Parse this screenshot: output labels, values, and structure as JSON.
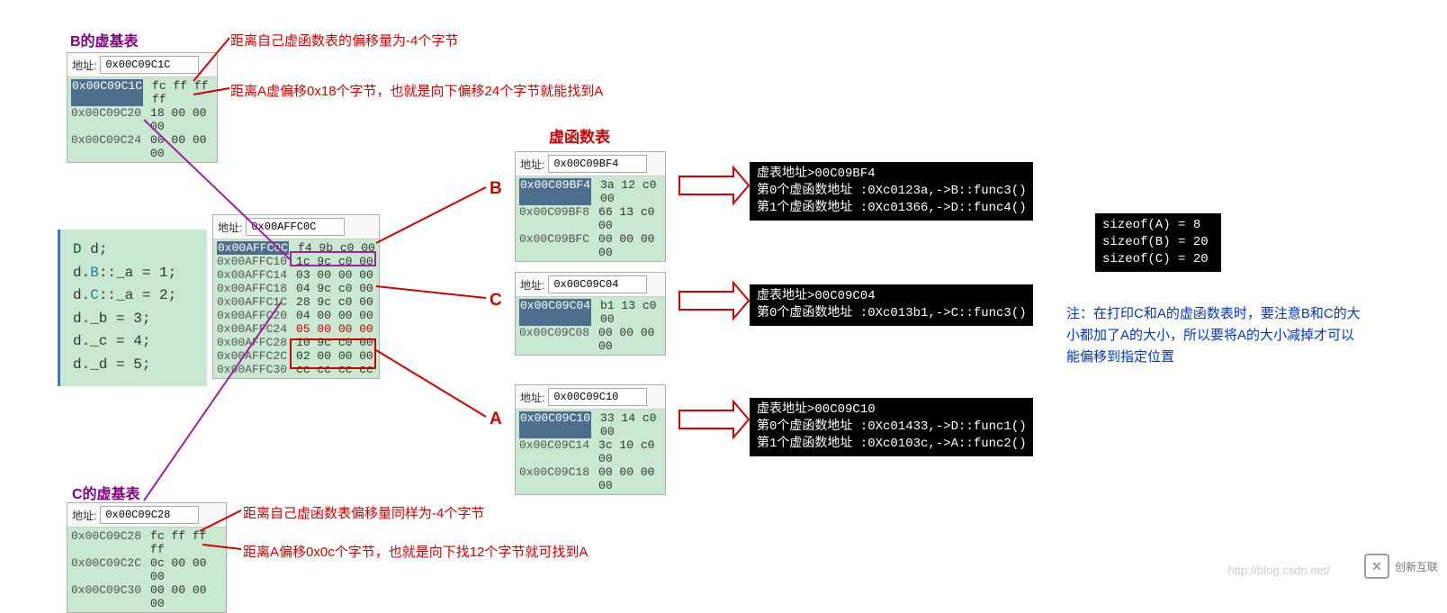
{
  "titles": {
    "b_vbtable": "B的虚基表",
    "c_vbtable": "C的虚基表",
    "vftable": "虚函数表"
  },
  "annotations": {
    "b_line1": "距离自己虚函数表的偏移量为-4个字节",
    "b_line2": "距离A虚偏移0x18个字节，也就是向下偏移24个字节就能找到A",
    "c_line1": "距离自己虚函数表偏移量同样为-4个字节",
    "c_line2": "距离A偏移0x0c个字节，也就是向下找12个字节就可找到A",
    "note_blue": "注：在打印C和A的虚函数表时，要注意B和C的大小都加了A的大小，所以要将A的大小减掉才可以能偏移到指定位置"
  },
  "letters": {
    "B": "B",
    "C": "C",
    "A": "A"
  },
  "mem_b": {
    "label": "地址:",
    "addr": "0x00C09C1C",
    "rows": [
      {
        "a": "0x00C09C1C",
        "b": "fc ff ff ff"
      },
      {
        "a": "0x00C09C20",
        "b": "18 00 00 00"
      },
      {
        "a": "0x00C09C24",
        "b": "00 00 00 00"
      }
    ]
  },
  "mem_c": {
    "label": "地址:",
    "addr": "0x00C09C28",
    "rows": [
      {
        "a": "0x00C09C28",
        "b": "fc ff ff ff"
      },
      {
        "a": "0x00C09C2C",
        "b": "0c 00 00 00"
      },
      {
        "a": "0x00C09C30",
        "b": "00 00 00 00"
      }
    ]
  },
  "mem_main": {
    "label": "地址:",
    "addr": "0x00AFFC0C",
    "rows": [
      {
        "a": "0x00AFFC0C",
        "b": "f4 9b c0 00"
      },
      {
        "a": "0x00AFFC10",
        "b": "1c 9c c0 00"
      },
      {
        "a": "0x00AFFC14",
        "b": "03 00 00 00"
      },
      {
        "a": "0x00AFFC18",
        "b": "04 9c c0 00"
      },
      {
        "a": "0x00AFFC1C",
        "b": "28 9c c0 00"
      },
      {
        "a": "0x00AFFC20",
        "b": "04 00 00 00"
      },
      {
        "a": "0x00AFFC24",
        "b": "05 00 00 00"
      },
      {
        "a": "0x00AFFC28",
        "b": "10 9c c0 00"
      },
      {
        "a": "0x00AFFC2C",
        "b": "02 00 00 00"
      },
      {
        "a": "0x00AFFC30",
        "b": "cc cc cc cc"
      }
    ]
  },
  "mem_vb": {
    "label": "地址:",
    "addr": "0x00C09BF4",
    "rows": [
      {
        "a": "0x00C09BF4",
        "b": "3a 12 c0 00"
      },
      {
        "a": "0x00C09BF8",
        "b": "66 13 c0 00"
      },
      {
        "a": "0x00C09BFC",
        "b": "00 00 00 00"
      }
    ]
  },
  "mem_vc": {
    "label": "地址:",
    "addr": "0x00C09C04",
    "rows": [
      {
        "a": "0x00C09C04",
        "b": "b1 13 c0 00"
      },
      {
        "a": "0x00C09C08",
        "b": "00 00 00 00"
      }
    ]
  },
  "mem_va": {
    "label": "地址:",
    "addr": "0x00C09C10",
    "rows": [
      {
        "a": "0x00C09C10",
        "b": "33 14 c0 00"
      },
      {
        "a": "0x00C09C14",
        "b": "3c 10 c0 00"
      },
      {
        "a": "0x00C09C18",
        "b": "00 00 00 00"
      }
    ]
  },
  "code": {
    "l1a": "D",
    "l1b": " d;",
    "l2a": "d.",
    "l2b": "B",
    "l2c": "::_a = 1;",
    "l3a": "d.",
    "l3b": "C",
    "l3c": "::_a = 2;",
    "l4": "d._b = 3;",
    "l5": "d._c = 4;",
    "l6": "d._d = 5;"
  },
  "term_b": "虚表地址>00C09BF4\n第0个虚函数地址 :0Xc0123a,->B::func3()\n第1个虚函数地址 :0Xc01366,->D::func4()",
  "term_c": "虚表地址>00C09C04\n第0个虚函数地址 :0Xc013b1,->C::func3()",
  "term_a": "虚表地址>00C09C10\n第0个虚函数地址 :0Xc01433,->D::func1()\n第1个虚函数地址 :0Xc0103c,->A::func2()",
  "term_sizeof": "sizeof(A) = 8\nsizeof(B) = 20\nsizeof(C) = 20",
  "wm": "http://blog.csdn.net/",
  "logo": "创新互联"
}
